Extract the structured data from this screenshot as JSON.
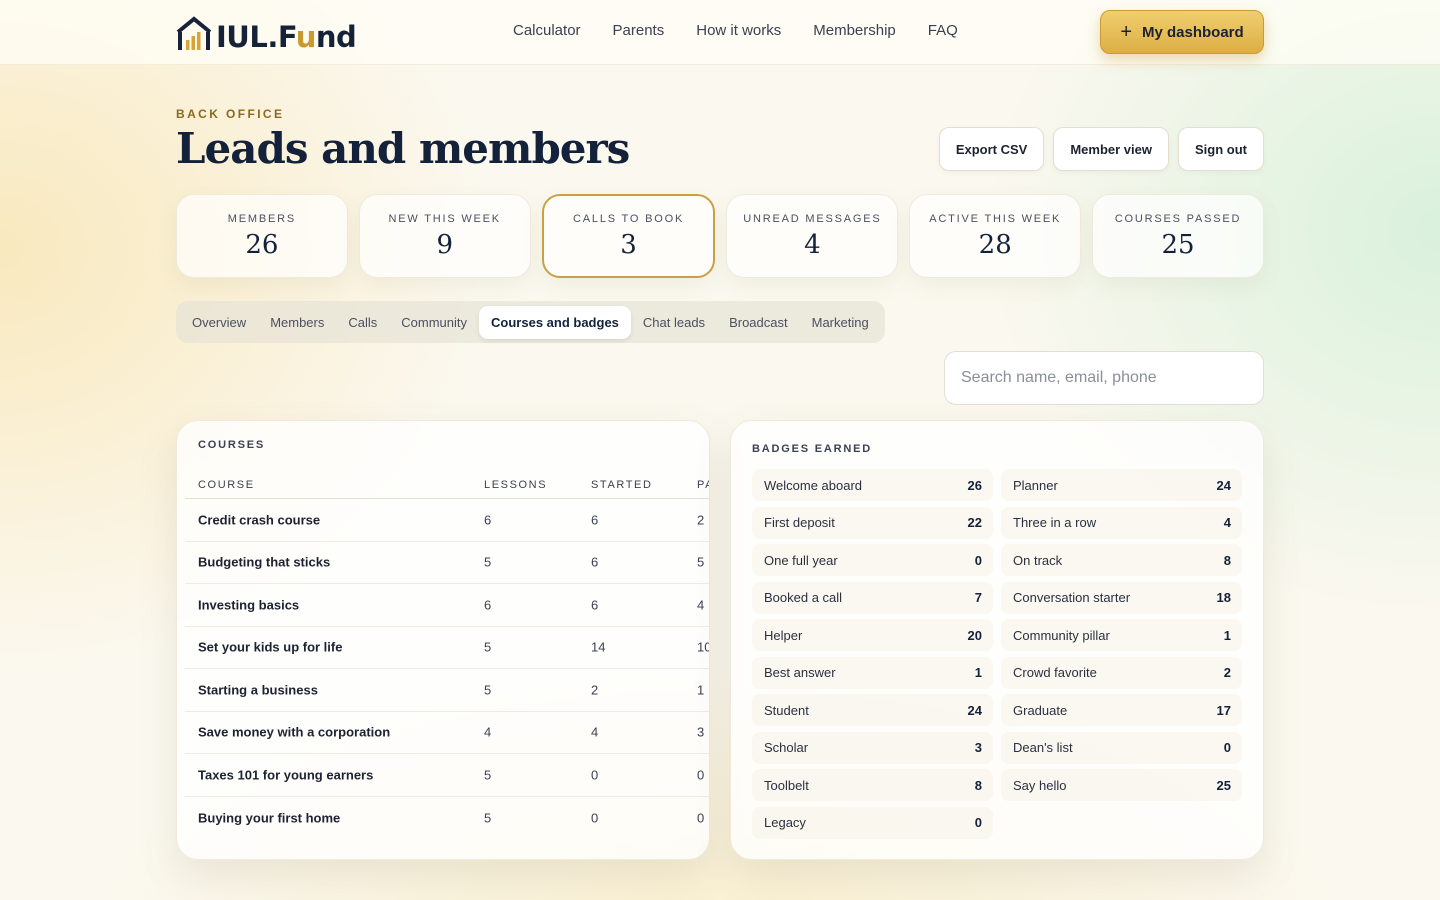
{
  "brand": {
    "name_main": "IUL.F",
    "name_gold": "u",
    "name_end": "nd"
  },
  "nav": [
    "Calculator",
    "Parents",
    "How it works",
    "Membership",
    "FAQ"
  ],
  "header": {
    "dashboard_label": "My dashboard"
  },
  "page": {
    "eyebrow": "BACK OFFICE",
    "title": "Leads and members"
  },
  "actions": {
    "export": "Export CSV",
    "member_view": "Member view",
    "sign_out": "Sign out"
  },
  "stats": [
    {
      "label": "MEMBERS",
      "value": "26"
    },
    {
      "label": "NEW THIS WEEK",
      "value": "9"
    },
    {
      "label": "CALLS TO BOOK",
      "value": "3"
    },
    {
      "label": "UNREAD MESSAGES",
      "value": "4"
    },
    {
      "label": "ACTIVE THIS WEEK",
      "value": "28"
    },
    {
      "label": "COURSES PASSED",
      "value": "25"
    }
  ],
  "tabs": [
    "Overview",
    "Members",
    "Calls",
    "Community",
    "Courses and badges",
    "Chat leads",
    "Broadcast",
    "Marketing"
  ],
  "active_tab": "Courses and badges",
  "search": {
    "placeholder": "Search name, email, phone",
    "value": ""
  },
  "courses": {
    "title": "COURSES",
    "columns": {
      "course": "COURSE",
      "lessons": "LESSONS",
      "started": "STARTED",
      "passed": "PA"
    },
    "rows": [
      {
        "name": "Credit crash course",
        "lessons": "6",
        "started": "6",
        "passed": "2"
      },
      {
        "name": "Budgeting that sticks",
        "lessons": "5",
        "started": "6",
        "passed": "5"
      },
      {
        "name": "Investing basics",
        "lessons": "6",
        "started": "6",
        "passed": "4"
      },
      {
        "name": "Set your kids up for life",
        "lessons": "5",
        "started": "14",
        "passed": "10"
      },
      {
        "name": "Starting a business",
        "lessons": "5",
        "started": "2",
        "passed": "1"
      },
      {
        "name": "Save money with a corporation",
        "lessons": "4",
        "started": "4",
        "passed": "3"
      },
      {
        "name": "Taxes 101 for young earners",
        "lessons": "5",
        "started": "0",
        "passed": "0"
      },
      {
        "name": "Buying your first home",
        "lessons": "5",
        "started": "0",
        "passed": "0"
      }
    ]
  },
  "badges": {
    "title": "BADGES EARNED",
    "items": [
      {
        "name": "Welcome aboard",
        "count": "26"
      },
      {
        "name": "Planner",
        "count": "24"
      },
      {
        "name": "First deposit",
        "count": "22"
      },
      {
        "name": "Three in a row",
        "count": "4"
      },
      {
        "name": "One full year",
        "count": "0"
      },
      {
        "name": "On track",
        "count": "8"
      },
      {
        "name": "Booked a call",
        "count": "7"
      },
      {
        "name": "Conversation starter",
        "count": "18"
      },
      {
        "name": "Helper",
        "count": "20"
      },
      {
        "name": "Community pillar",
        "count": "1"
      },
      {
        "name": "Best answer",
        "count": "1"
      },
      {
        "name": "Crowd favorite",
        "count": "2"
      },
      {
        "name": "Student",
        "count": "24"
      },
      {
        "name": "Graduate",
        "count": "17"
      },
      {
        "name": "Scholar",
        "count": "3"
      },
      {
        "name": "Dean's list",
        "count": "0"
      },
      {
        "name": "Toolbelt",
        "count": "8"
      },
      {
        "name": "Say hello",
        "count": "25"
      },
      {
        "name": "Legacy",
        "count": "0"
      }
    ]
  },
  "colors": {
    "accent_gold": "#ddae45",
    "navy": "#14213a",
    "background": "#fbf8ef"
  },
  "icons": {
    "logo": "house-bar-chart-icon",
    "dashboard": "plus-icon"
  }
}
